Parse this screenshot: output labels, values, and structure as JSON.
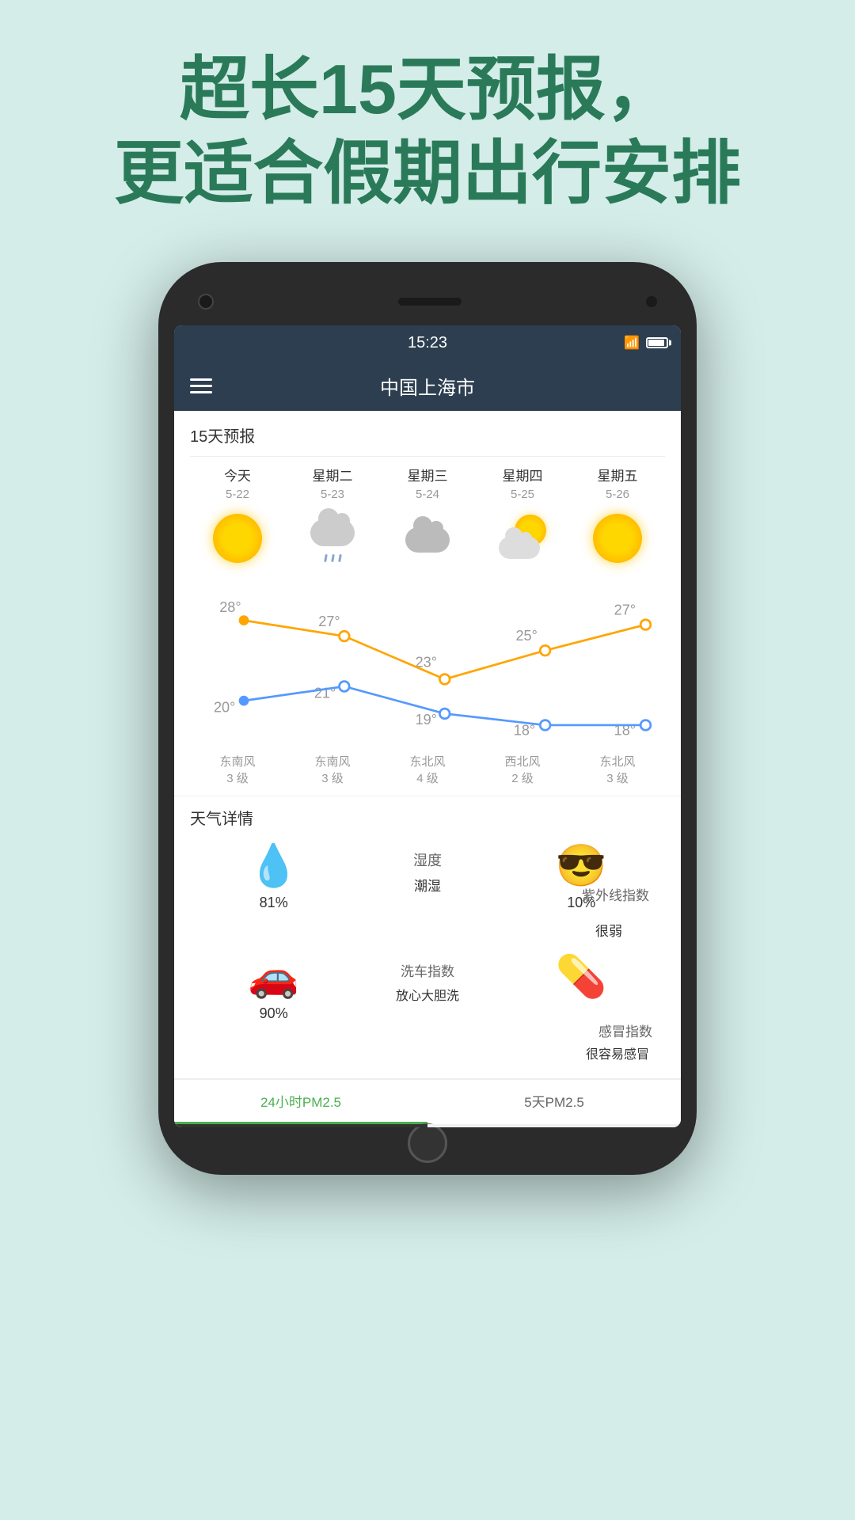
{
  "page": {
    "bg_color": "#d4ede8",
    "header_line1": "超长15天预报，",
    "header_line2": "更适合假期出行安排"
  },
  "status_bar": {
    "time": "15:23",
    "wifi": "wifi",
    "battery": "battery"
  },
  "app_bar": {
    "title": "中国上海市",
    "menu": "menu"
  },
  "forecast": {
    "section_title": "15天预报",
    "days": [
      {
        "name": "今天",
        "date": "5-22",
        "icon": "sunny",
        "high": "28°",
        "low": "20°",
        "wind_dir": "东南风",
        "wind_level": "3 级"
      },
      {
        "name": "星期二",
        "date": "5-23",
        "icon": "rainy",
        "high": "27°",
        "low": "21°",
        "wind_dir": "东南风",
        "wind_level": "3 级"
      },
      {
        "name": "星期三",
        "date": "5-24",
        "icon": "cloudy",
        "high": "23°",
        "low": "19°",
        "wind_dir": "东北风",
        "wind_level": "4 级"
      },
      {
        "name": "星期四",
        "date": "5-25",
        "icon": "partly_cloudy",
        "high": "25°",
        "low": "18°",
        "wind_dir": "西北风",
        "wind_level": "2 级"
      },
      {
        "name": "星期五",
        "date": "5-26",
        "icon": "sunny",
        "high": "27°",
        "low": "18°",
        "wind_dir": "东北风",
        "wind_level": "3 级"
      }
    ],
    "high_temps": [
      28,
      27,
      23,
      25,
      27
    ],
    "low_temps": [
      20,
      21,
      19,
      18,
      18
    ]
  },
  "details": {
    "section_title": "天气详情",
    "humidity_label": "湿度",
    "humidity_value": "81%",
    "humidity_desc": "潮湿",
    "uv_label": "紫外线指数",
    "uv_value": "10%",
    "uv_desc": "很弱",
    "carwash_label": "洗车指数",
    "carwash_value": "90%",
    "carwash_desc": "放心大胆洗",
    "illness_label": "感冒指数",
    "illness_value": "",
    "illness_desc": "很容易感冒"
  },
  "bottom_tabs": {
    "tab1_label": "24小时PM2.5",
    "tab2_label": "5天PM2.5"
  }
}
